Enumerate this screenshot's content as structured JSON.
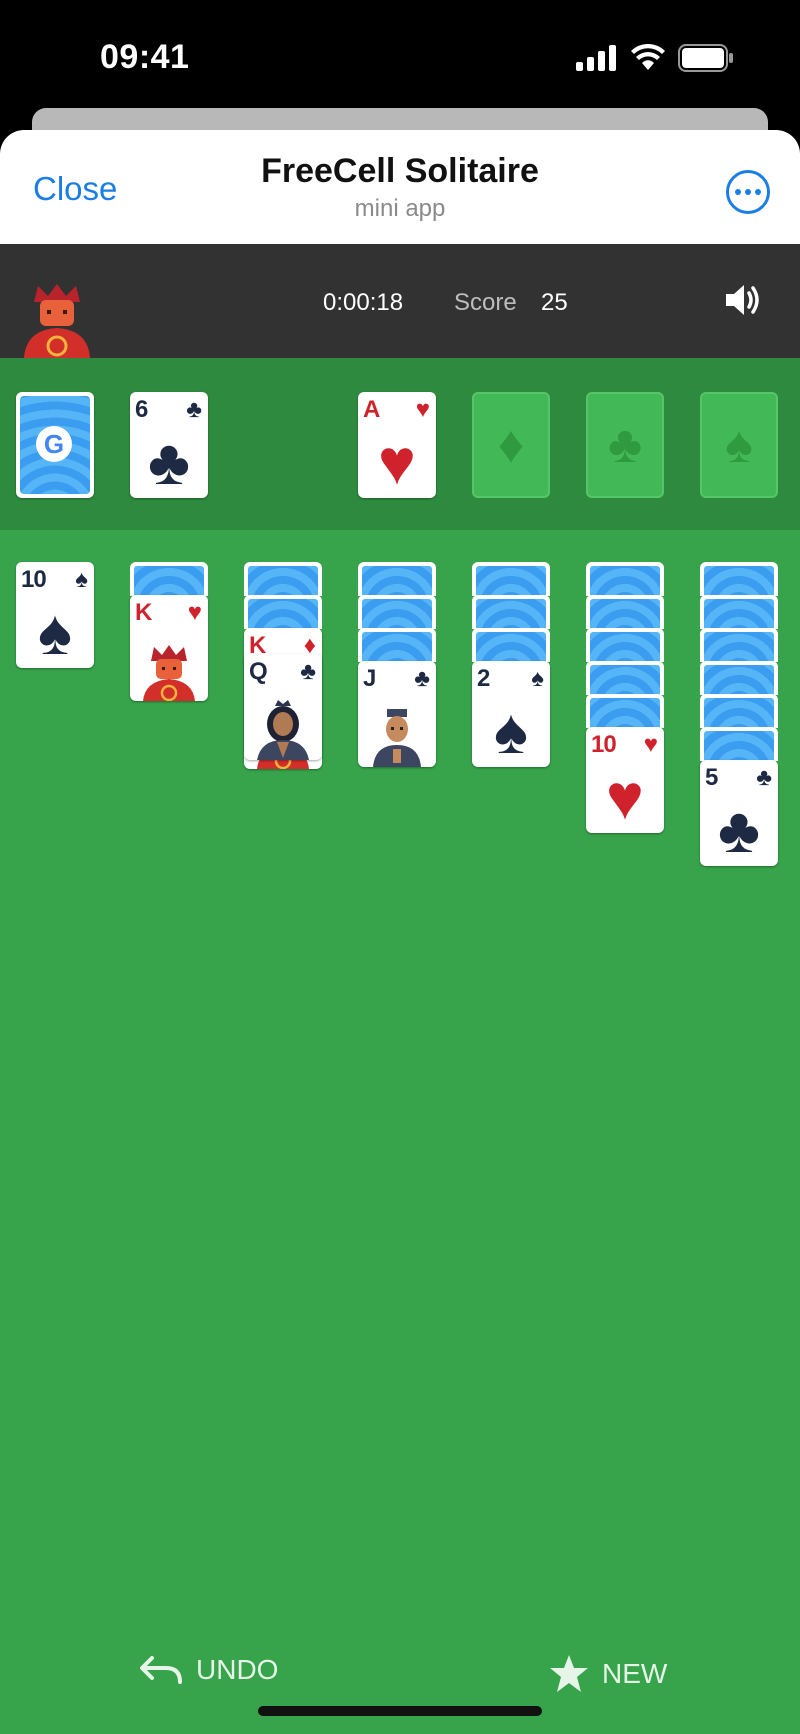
{
  "status": {
    "time": "09:41"
  },
  "header": {
    "close_label": "Close",
    "title": "FreeCell Solitaire",
    "subtitle": "mini app"
  },
  "game": {
    "timer": "0:00:18",
    "score_label": "Score",
    "score": "25"
  },
  "stock": {
    "logo": "G"
  },
  "waste": {
    "rank": "6",
    "suit": "♣",
    "color": "black"
  },
  "foundations": [
    {
      "rank": "A",
      "suit": "♥",
      "color": "red",
      "filled": true
    },
    {
      "suit": "♦",
      "filled": false
    },
    {
      "suit": "♣",
      "filled": false
    },
    {
      "suit": "♠",
      "filled": false
    }
  ],
  "tableau": [
    {
      "hidden": 0,
      "faceup": [
        {
          "rank": "10",
          "suit": "♠",
          "color": "black"
        }
      ]
    },
    {
      "hidden": 1,
      "faceup": [
        {
          "rank": "K",
          "suit": "♥",
          "color": "red"
        }
      ]
    },
    {
      "hidden": 2,
      "faceup": [
        {
          "rank": "K",
          "suit": "♦",
          "color": "red"
        },
        {
          "rank": "Q",
          "suit": "♣",
          "color": "black"
        }
      ]
    },
    {
      "hidden": 3,
      "faceup": [
        {
          "rank": "J",
          "suit": "♣",
          "color": "black"
        }
      ]
    },
    {
      "hidden": 3,
      "faceup": [
        {
          "rank": "2",
          "suit": "♠",
          "color": "black"
        }
      ]
    },
    {
      "hidden": 5,
      "faceup": [
        {
          "rank": "10",
          "suit": "♥",
          "color": "red"
        }
      ]
    },
    {
      "hidden": 6,
      "faceup": [
        {
          "rank": "5",
          "suit": "♣",
          "color": "black"
        }
      ]
    }
  ],
  "controls": {
    "undo_label": "UNDO",
    "new_label": "NEW"
  },
  "colors": {
    "felt": "#37a34a",
    "felt_dark": "#2e8a3e",
    "info_bar": "#323232",
    "accent": "#1a7ee6"
  }
}
